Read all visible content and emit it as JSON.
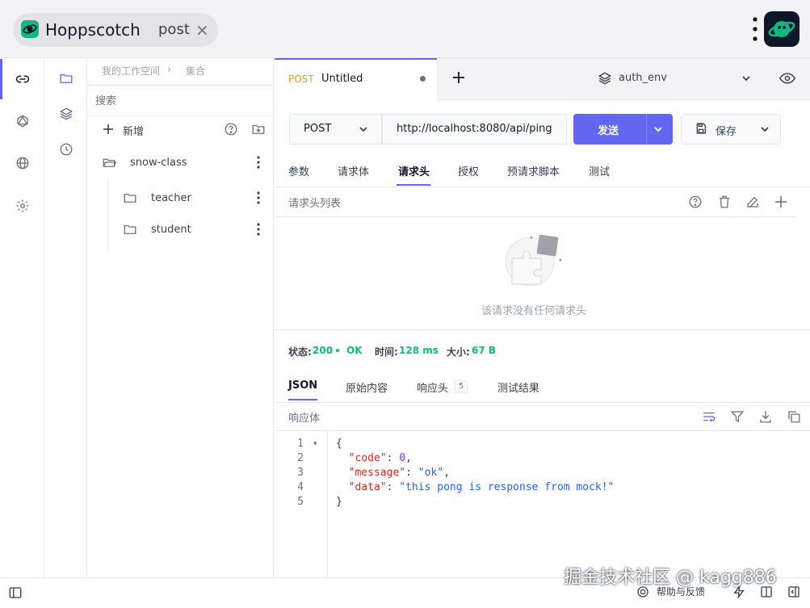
{
  "app": {
    "name": "Hoppscotch",
    "window_tab": "post"
  },
  "breadcrumb": {
    "workspace": "我的工作空间",
    "section": "集合"
  },
  "collections": {
    "search_placeholder": "搜索",
    "new_label": "新增",
    "root": {
      "name": "snow-class",
      "children": [
        "teacher",
        "student"
      ]
    }
  },
  "request_tab": {
    "method": "POST",
    "name": "Untitled"
  },
  "environment": {
    "name": "auth_env"
  },
  "request": {
    "method": "POST",
    "url": "http://localhost:8080/api/ping",
    "send_label": "发送",
    "save_label": "保存"
  },
  "request_subtabs": [
    "参数",
    "请求体",
    "请求头",
    "授权",
    "预请求脚本",
    "测试"
  ],
  "active_subtab": "请求头",
  "headers_panel": {
    "title": "请求头列表",
    "empty_message": "该请求没有任何请求头"
  },
  "response_meta": {
    "status_label": "状态:",
    "status_code": "200",
    "status_text": "OK",
    "time_label": "时间:",
    "time_value": "128 ms",
    "size_label": "大小:",
    "size_value": "67 B"
  },
  "response_tabs": {
    "json": "JSON",
    "raw": "原始内容",
    "headers": "响应头",
    "headers_count": "5",
    "tests": "测试结果"
  },
  "response_body": {
    "title": "响应体",
    "line_numbers": [
      "1",
      "2",
      "3",
      "4",
      "5"
    ],
    "json": {
      "code": 0,
      "message": "ok",
      "data": "this pong is response from mock!"
    }
  },
  "footer": {
    "help_label": "帮助与反馈"
  },
  "watermark": "掘金技术社区 @ kagg886",
  "colors": {
    "accent": "#6366f1",
    "success": "#10b981",
    "brand": "#10b981"
  }
}
